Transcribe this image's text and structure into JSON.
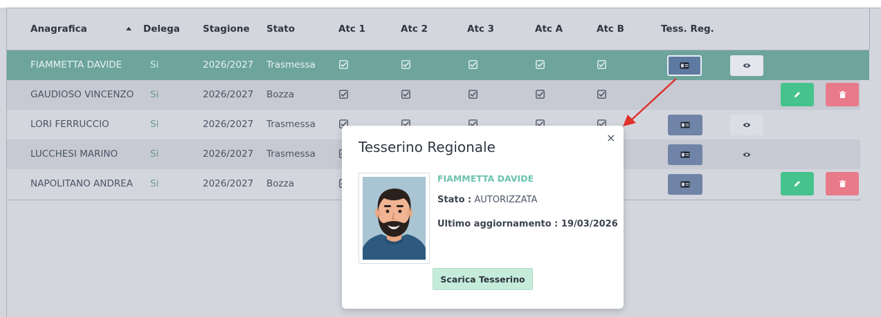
{
  "table": {
    "columns": {
      "anagrafica": "Anagrafica",
      "delega": "Delega",
      "stagione": "Stagione",
      "stato": "Stato",
      "atc1": "Atc 1",
      "atc2": "Atc 2",
      "atc3": "Atc 3",
      "atca": "Atc A",
      "atcb": "Atc B",
      "tess": "Tess. Reg."
    },
    "sort_icon": "sort-ascending-icon",
    "rows": [
      {
        "name": "FIAMMETTA DAVIDE",
        "delega": "Si",
        "stagione": "2026/2027",
        "stato": "Trasmessa"
      },
      {
        "name": "GAUDIOSO VINCENZO",
        "delega": "Si",
        "stagione": "2026/2027",
        "stato": "Bozza"
      },
      {
        "name": "LORI FERRUCCIO",
        "delega": "Si",
        "stagione": "2026/2027",
        "stato": "Trasmessa"
      },
      {
        "name": "LUCCHESI MARINO",
        "delega": "Si",
        "stagione": "2026/2027",
        "stato": "Trasmessa"
      },
      {
        "name": "NAPOLITANO ANDREA",
        "delega": "Si",
        "stagione": "2026/2027",
        "stato": "Bozza"
      }
    ],
    "icons": {
      "check": "checkbox-checked-icon",
      "tessera": "id-card-icon",
      "view": "eye-icon",
      "edit": "pencil-icon",
      "delete": "trash-icon"
    },
    "colors": {
      "selected_row": "#6da49c",
      "edit_button": "#46c38d",
      "delete_button": "#e97a8a",
      "tess_button": "#6f84a6"
    }
  },
  "popup": {
    "title": "Tesserino Regionale",
    "close": "×",
    "name": "FIAMMETTA DAVIDE",
    "stato_label": "Stato :",
    "stato_value": "AUTORIZZATA",
    "update_text": "Ultimo aggiornamento : 19/03/2026",
    "download_button": "Scarica Tesserino",
    "photo": "avatar-photo"
  },
  "annotation": {
    "arrow_color": "#e0312c"
  }
}
